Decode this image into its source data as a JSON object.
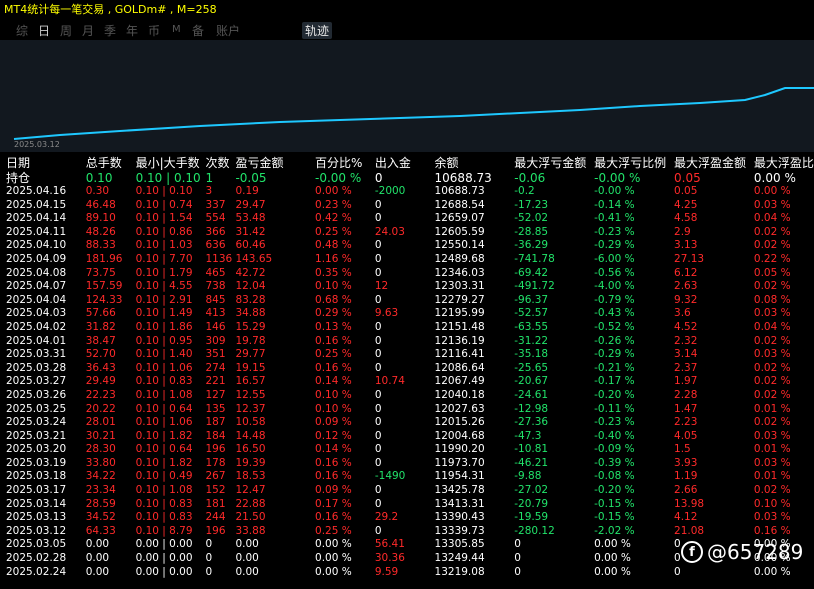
{
  "title": "MT4统计每一笔交易 , GOLDm# , M=258",
  "toolbar": {
    "items": [
      "综",
      "日",
      "周",
      "月",
      "季",
      "年",
      "币",
      "M",
      "备",
      "账户"
    ],
    "active_index": 1,
    "trajectory_label": "轨迹"
  },
  "chart": {
    "start_date_label": "2025.03.12",
    "line_color": "#1ec8ff"
  },
  "colors": {
    "loss": "#ff2a2a",
    "profit": "#21e36a",
    "neutral": "#ffffff"
  },
  "table": {
    "headers": [
      "日期",
      "总手数",
      "最小|大手数",
      "次数",
      "盈亏金额",
      "百分比%",
      "出入金",
      "余额",
      "最大浮亏金额",
      "最大浮亏比例",
      "最大浮盈金额",
      "最大浮盈比"
    ],
    "position_row": {
      "label": "持仓",
      "lots": "0.10",
      "minmax": "0.10 | 0.10",
      "count": "1",
      "pnl": "-0.05",
      "pct": "-0.00 %",
      "cash": "0",
      "balance": "10688.73",
      "max_dd": "-0.06",
      "max_dd_pct": "-0.00 %",
      "max_fp": "0.05",
      "max_fp_pct": "0.00 %"
    },
    "rows": [
      [
        "2025.04.16",
        "0.30",
        "0.10 | 0.10",
        "3",
        "0.19",
        "0.00 %",
        "-2000",
        "10688.73",
        "-0.2",
        "-0.00 %",
        "0.05",
        "0.00 %"
      ],
      [
        "2025.04.15",
        "46.48",
        "0.10 | 0.74",
        "337",
        "29.47",
        "0.23 %",
        "0",
        "12688.54",
        "-17.23",
        "-0.14 %",
        "4.25",
        "0.03 %"
      ],
      [
        "2025.04.14",
        "89.10",
        "0.10 | 1.54",
        "554",
        "53.48",
        "0.42 %",
        "0",
        "12659.07",
        "-52.02",
        "-0.41 %",
        "4.58",
        "0.04 %"
      ],
      [
        "2025.04.11",
        "48.26",
        "0.10 | 0.86",
        "366",
        "31.42",
        "0.25 %",
        "24.03",
        "12605.59",
        "-28.85",
        "-0.23 %",
        "2.9",
        "0.02 %"
      ],
      [
        "2025.04.10",
        "88.33",
        "0.10 | 1.03",
        "636",
        "60.46",
        "0.48 %",
        "0",
        "12550.14",
        "-36.29",
        "-0.29 %",
        "3.13",
        "0.02 %"
      ],
      [
        "2025.04.09",
        "181.96",
        "0.10 | 7.70",
        "1136",
        "143.65",
        "1.16 %",
        "0",
        "12489.68",
        "-741.78",
        "-6.00 %",
        "27.13",
        "0.22 %"
      ],
      [
        "2025.04.08",
        "73.75",
        "0.10 | 1.79",
        "465",
        "42.72",
        "0.35 %",
        "0",
        "12346.03",
        "-69.42",
        "-0.56 %",
        "6.12",
        "0.05 %"
      ],
      [
        "2025.04.07",
        "157.59",
        "0.10 | 4.55",
        "738",
        "12.04",
        "0.10 %",
        "12",
        "12303.31",
        "-491.72",
        "-4.00 %",
        "2.63",
        "0.02 %"
      ],
      [
        "2025.04.04",
        "124.33",
        "0.10 | 2.91",
        "845",
        "83.28",
        "0.68 %",
        "0",
        "12279.27",
        "-96.37",
        "-0.79 %",
        "9.32",
        "0.08 %"
      ],
      [
        "2025.04.03",
        "57.66",
        "0.10 | 1.49",
        "413",
        "34.88",
        "0.29 %",
        "9.63",
        "12195.99",
        "-52.57",
        "-0.43 %",
        "3.6",
        "0.03 %"
      ],
      [
        "2025.04.02",
        "31.82",
        "0.10 | 1.86",
        "146",
        "15.29",
        "0.13 %",
        "0",
        "12151.48",
        "-63.55",
        "-0.52 %",
        "4.52",
        "0.04 %"
      ],
      [
        "2025.04.01",
        "38.47",
        "0.10 | 0.95",
        "309",
        "19.78",
        "0.16 %",
        "0",
        "12136.19",
        "-31.22",
        "-0.26 %",
        "2.32",
        "0.02 %"
      ],
      [
        "2025.03.31",
        "52.70",
        "0.10 | 1.40",
        "351",
        "29.77",
        "0.25 %",
        "0",
        "12116.41",
        "-35.18",
        "-0.29 %",
        "3.14",
        "0.03 %"
      ],
      [
        "2025.03.28",
        "36.43",
        "0.10 | 1.06",
        "274",
        "19.15",
        "0.16 %",
        "0",
        "12086.64",
        "-25.65",
        "-0.21 %",
        "2.37",
        "0.02 %"
      ],
      [
        "2025.03.27",
        "29.49",
        "0.10 | 0.83",
        "221",
        "16.57",
        "0.14 %",
        "10.74",
        "12067.49",
        "-20.67",
        "-0.17 %",
        "1.97",
        "0.02 %"
      ],
      [
        "2025.03.26",
        "22.23",
        "0.10 | 1.08",
        "127",
        "12.55",
        "0.10 %",
        "0",
        "12040.18",
        "-24.61",
        "-0.20 %",
        "2.28",
        "0.02 %"
      ],
      [
        "2025.03.25",
        "20.22",
        "0.10 | 0.64",
        "135",
        "12.37",
        "0.10 %",
        "0",
        "12027.63",
        "-12.98",
        "-0.11 %",
        "1.47",
        "0.01 %"
      ],
      [
        "2025.03.24",
        "28.01",
        "0.10 | 1.06",
        "187",
        "10.58",
        "0.09 %",
        "0",
        "12015.26",
        "-27.36",
        "-0.23 %",
        "2.23",
        "0.02 %"
      ],
      [
        "2025.03.21",
        "30.21",
        "0.10 | 1.82",
        "184",
        "14.48",
        "0.12 %",
        "0",
        "12004.68",
        "-47.3",
        "-0.40 %",
        "4.05",
        "0.03 %"
      ],
      [
        "2025.03.20",
        "28.30",
        "0.10 | 0.64",
        "196",
        "16.50",
        "0.14 %",
        "0",
        "11990.20",
        "-10.81",
        "-0.09 %",
        "1.5",
        "0.01 %"
      ],
      [
        "2025.03.19",
        "33.80",
        "0.10 | 1.82",
        "178",
        "19.39",
        "0.16 %",
        "0",
        "11973.70",
        "-46.21",
        "-0.39 %",
        "3.93",
        "0.03 %"
      ],
      [
        "2025.03.18",
        "34.22",
        "0.10 | 0.49",
        "267",
        "18.53",
        "0.16 %",
        "-1490",
        "11954.31",
        "-9.88",
        "-0.08 %",
        "1.19",
        "0.01 %"
      ],
      [
        "2025.03.17",
        "23.34",
        "0.10 | 1.08",
        "152",
        "12.47",
        "0.09 %",
        "0",
        "13425.78",
        "-27.02",
        "-0.20 %",
        "2.66",
        "0.02 %"
      ],
      [
        "2025.03.14",
        "28.59",
        "0.10 | 0.83",
        "181",
        "22.88",
        "0.17 %",
        "0",
        "13413.31",
        "-20.79",
        "-0.15 %",
        "13.98",
        "0.10 %"
      ],
      [
        "2025.03.13",
        "34.52",
        "0.10 | 0.83",
        "244",
        "21.50",
        "0.16 %",
        "29.2",
        "13390.43",
        "-19.59",
        "-0.15 %",
        "4.12",
        "0.03 %"
      ],
      [
        "2025.03.12",
        "64.33",
        "0.10 | 8.79",
        "196",
        "33.88",
        "0.25 %",
        "0",
        "13339.73",
        "-280.12",
        "-2.02 %",
        "21.08",
        "0.16 %"
      ],
      [
        "2025.03.05",
        "0.00",
        "0.00 | 0.00",
        "0",
        "0.00",
        "0.00 %",
        "56.41",
        "13305.85",
        "0",
        "0.00 %",
        "0",
        "0.00 %"
      ],
      [
        "2025.02.28",
        "0.00",
        "0.00 | 0.00",
        "0",
        "0.00",
        "0.00 %",
        "30.36",
        "13249.44",
        "0",
        "0.00 %",
        "0",
        "0.00 %"
      ],
      [
        "2025.02.24",
        "0.00",
        "0.00 | 0.00",
        "0",
        "0.00",
        "0.00 %",
        "9.59",
        "13219.08",
        "0",
        "0.00 %",
        "0",
        "0.00 %"
      ]
    ]
  },
  "watermark": {
    "text": "@657289"
  }
}
